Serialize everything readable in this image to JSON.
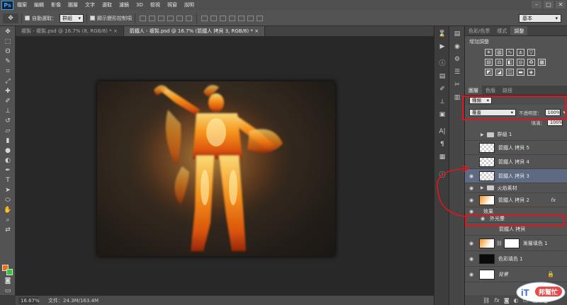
{
  "app": {
    "logo": "Ps"
  },
  "menu": [
    "檔案",
    "編輯",
    "影像",
    "圖層",
    "文字",
    "選取",
    "濾鏡",
    "3D",
    "檢視",
    "視窗",
    "說明"
  ],
  "window_controls": {
    "minimize": "–",
    "maximize": "□",
    "close": "✕"
  },
  "options_bar": {
    "move_tool_icon": "move-tool",
    "auto_select_label": "自動選取：",
    "auto_select_value": "群組",
    "show_transform_label": "顯示變形控制項",
    "workspace": "基本"
  },
  "tabs": [
    {
      "label": "複製 - 複製.psd @ 16.7% (8, RGB/8) *",
      "active": false,
      "close": "×"
    },
    {
      "label": "箭鐵人 - 複製.psd @ 16.7% (箭鐵人 拷貝 3, RGB/8) *",
      "active": true,
      "close": "×"
    }
  ],
  "status": {
    "zoom": "16.67%",
    "doc": "文件：24.3M/163.4M"
  },
  "panels": {
    "top_tabs": [
      "色彩/色票",
      "樣式",
      "調整"
    ],
    "top_active": "調整",
    "adjust_title": "增加調整",
    "layer_tabs": [
      "圖層",
      "色版",
      "路徑"
    ],
    "layer_active": "圖層",
    "kind_label": "種類",
    "blend_mode": "覆蓋",
    "opacity_label": "不透明度：",
    "opacity_value": "100%",
    "fill_label": "填滿：",
    "fill_value": "100%"
  },
  "layers": [
    {
      "name": "群組 1",
      "type": "group",
      "visible": false
    },
    {
      "name": "箭鐵人 拷貝 5",
      "type": "layer",
      "visible": false
    },
    {
      "name": "箭鐵人 拷貝 4",
      "type": "layer",
      "visible": false
    },
    {
      "name": "箭鐵人 拷貝 3",
      "type": "layer",
      "visible": true,
      "selected": true
    },
    {
      "name": "火焰素材",
      "type": "group",
      "visible": true
    },
    {
      "name": "箭鐵人 拷貝 2",
      "type": "layer",
      "visible": true,
      "fx": "fx"
    },
    {
      "name": "效果",
      "type": "effect",
      "visible": true
    },
    {
      "name": "外光暈",
      "type": "effect",
      "visible": true
    },
    {
      "name": "箭鐵人 拷貝",
      "type": "layer",
      "visible": false
    },
    {
      "name": "漸層填色 1",
      "type": "fill",
      "visible": true
    },
    {
      "name": "色彩填色 1",
      "type": "fill",
      "visible": true
    },
    {
      "name": "背景",
      "type": "background",
      "visible": true,
      "locked": true
    }
  ],
  "layers_bottom_icons": [
    "link-icon",
    "fx-icon",
    "mask-icon",
    "adjust-icon",
    "folder-icon",
    "new-layer-icon",
    "trash-icon"
  ],
  "watermark": {
    "text": "iT邦幫忙"
  },
  "colors": {
    "foreground": "#f26d0f",
    "background": "#2ec93a",
    "annotation": "#e3141b"
  }
}
